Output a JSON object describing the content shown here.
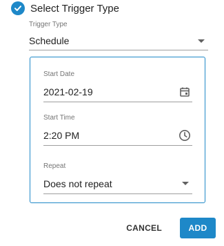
{
  "header": {
    "title": "Select Trigger Type",
    "icon": "check-circle-icon",
    "accent_color": "#1e88c8"
  },
  "trigger_type": {
    "label": "Trigger Type",
    "value": "Schedule"
  },
  "schedule": {
    "start_date": {
      "label": "Start Date",
      "value": "2021-02-19",
      "icon": "calendar-icon"
    },
    "start_time": {
      "label": "Start Time",
      "value": "2:20 PM",
      "icon": "clock-icon"
    },
    "repeat": {
      "label": "Repeat",
      "value": "Does not repeat"
    }
  },
  "actions": {
    "cancel_label": "CANCEL",
    "add_label": "ADD"
  }
}
